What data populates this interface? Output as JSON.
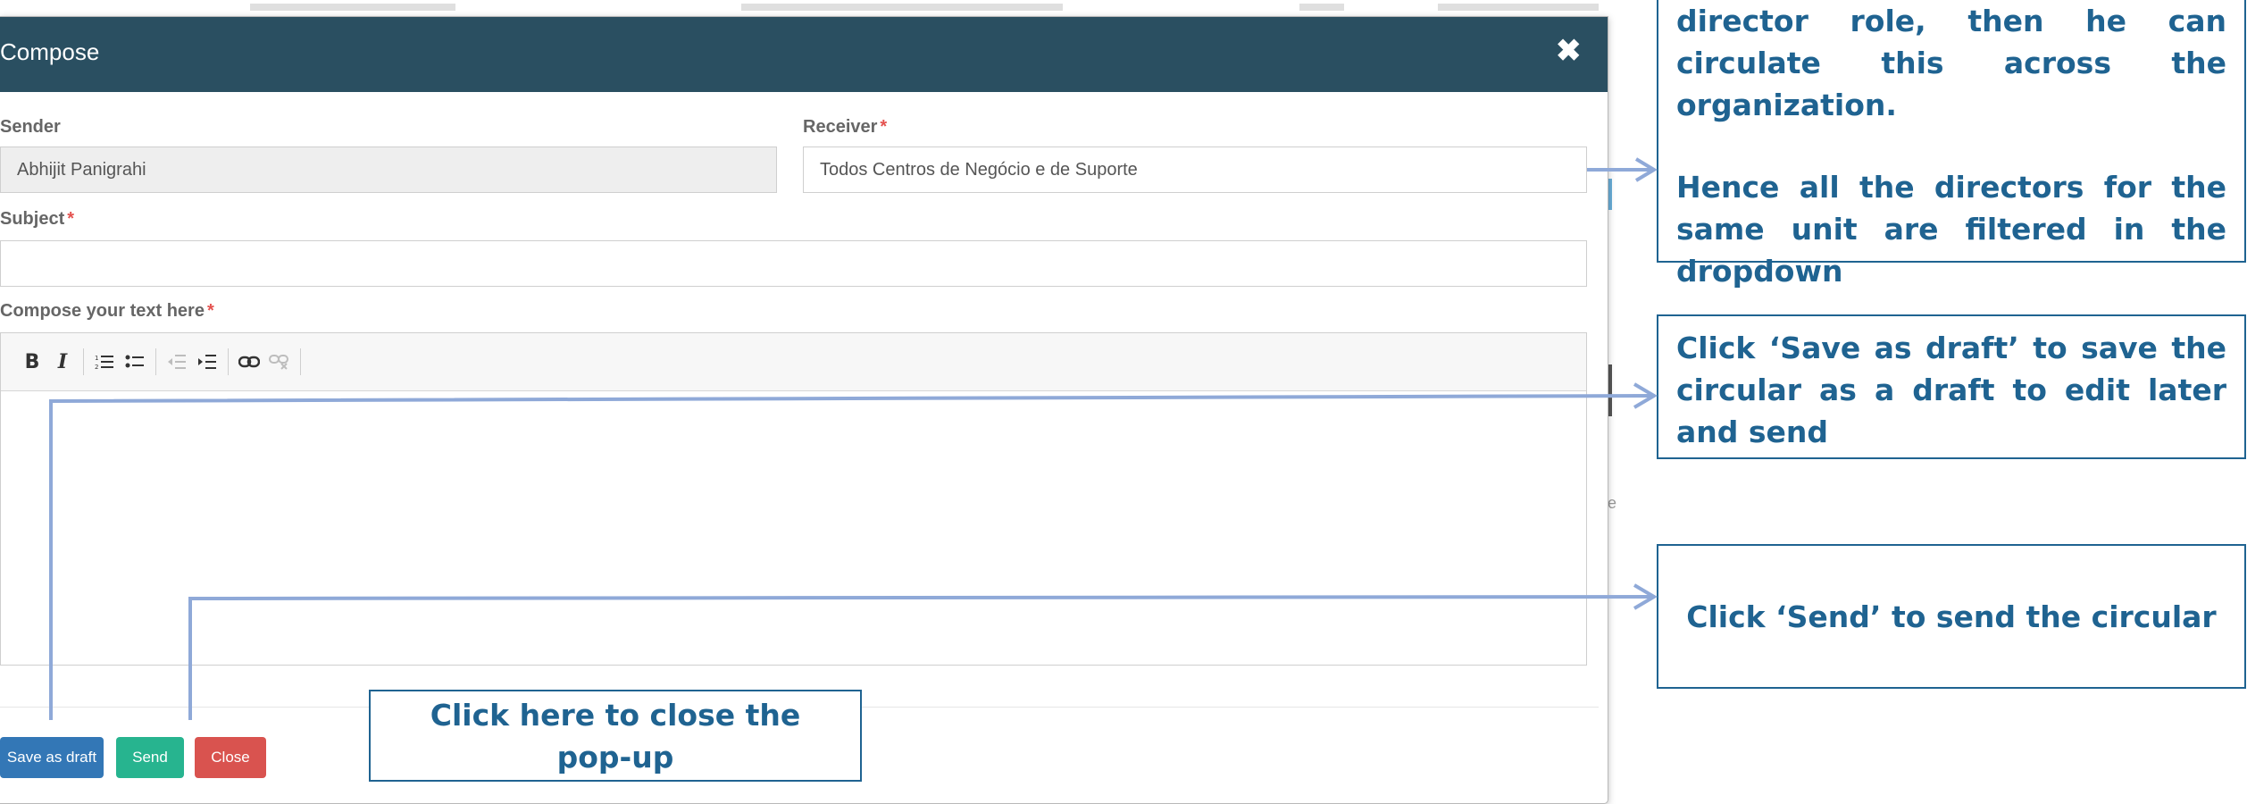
{
  "modal": {
    "title": "Compose",
    "close_icon": "close-icon"
  },
  "form": {
    "sender_label": "Sender",
    "sender_value": "Abhijit Panigrahi",
    "receiver_label": "Receiver",
    "receiver_value": "Todos Centros de Negócio e de Suporte",
    "required_mark": "*",
    "subject_label": "Subject",
    "subject_value": "",
    "compose_label": "Compose your text here"
  },
  "toolbar": {
    "bold": "B",
    "italic": "I",
    "ordered_list_icon": "ordered-list-icon",
    "bullet_list_icon": "bullet-list-icon",
    "outdent_icon": "outdent-icon",
    "indent_icon": "indent-icon",
    "link_icon": "link-icon",
    "unlink_icon": "unlink-icon"
  },
  "buttons": {
    "save_draft": "Save as draft",
    "send": "Send",
    "close": "Close"
  },
  "callouts": {
    "receiver_text": "director role, then he can circulate this across the organization.",
    "receiver_text2": "Hence all the directors for the same unit are filtered in the dropdown",
    "draft_text": "Click ‘Save as draft’ to save the circular as a draft to edit later and send",
    "send_text": "Click ‘Send’ to send the circular",
    "close_text": "Click here to close the pop-up"
  },
  "background": {
    "partial_letter": "e"
  },
  "colors": {
    "header": "#2a4f61",
    "draft": "#3377b6",
    "send": "#27b48f",
    "close": "#d9534f",
    "callout": "#1f6391",
    "connector": "#8fa9d8"
  }
}
